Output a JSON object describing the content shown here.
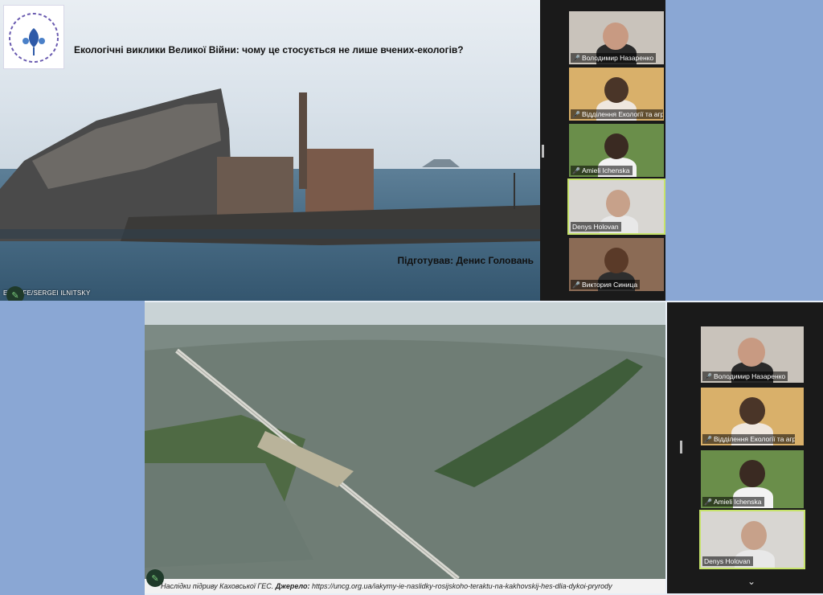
{
  "top_slide": {
    "title": "Екологічні виклики Великої Війни: чому це стосується не лише вчених-екологів?",
    "prepared_by": "Підготував: Денис Головань",
    "photo_credit": "EPA-EFE/SERGEI ILNITSKY"
  },
  "bottom_slide": {
    "caption_prefix": "Наслідки підриву Каховської ГЕС.",
    "caption_source_label": "Джерело:",
    "caption_url": "https://uncg.org.ua/iakymy-ie-naslidky-rosijskoho-teraktu-na-kakhovskij-hes-dlia-dykoi-pryrody"
  },
  "participants_top": [
    {
      "name": "Володимир Назаренко",
      "muted": true
    },
    {
      "name": "Відділення Екології та агр...",
      "muted": true
    },
    {
      "name": "Amieli Ichenska",
      "muted": true
    },
    {
      "name": "Denys Holovan",
      "muted": false,
      "active": true
    },
    {
      "name": "Виктория Синица",
      "muted": true
    }
  ],
  "participants_bottom": [
    {
      "name": "Володимир Назаренко",
      "muted": true
    },
    {
      "name": "Відділення Екології та агра...",
      "muted": true
    },
    {
      "name": "Amieli Ichenska",
      "muted": true
    },
    {
      "name": "Denys Holovan",
      "muted": false,
      "active": true
    }
  ],
  "icons": {
    "mic_muted": "mic-off-icon",
    "annotate": "pen-icon",
    "scroll": "chevron-down-icon"
  },
  "colors": {
    "active_speaker": "#c6e36a",
    "muted_mic": "#e23d3d",
    "background_blue": "#8aa7d4"
  }
}
